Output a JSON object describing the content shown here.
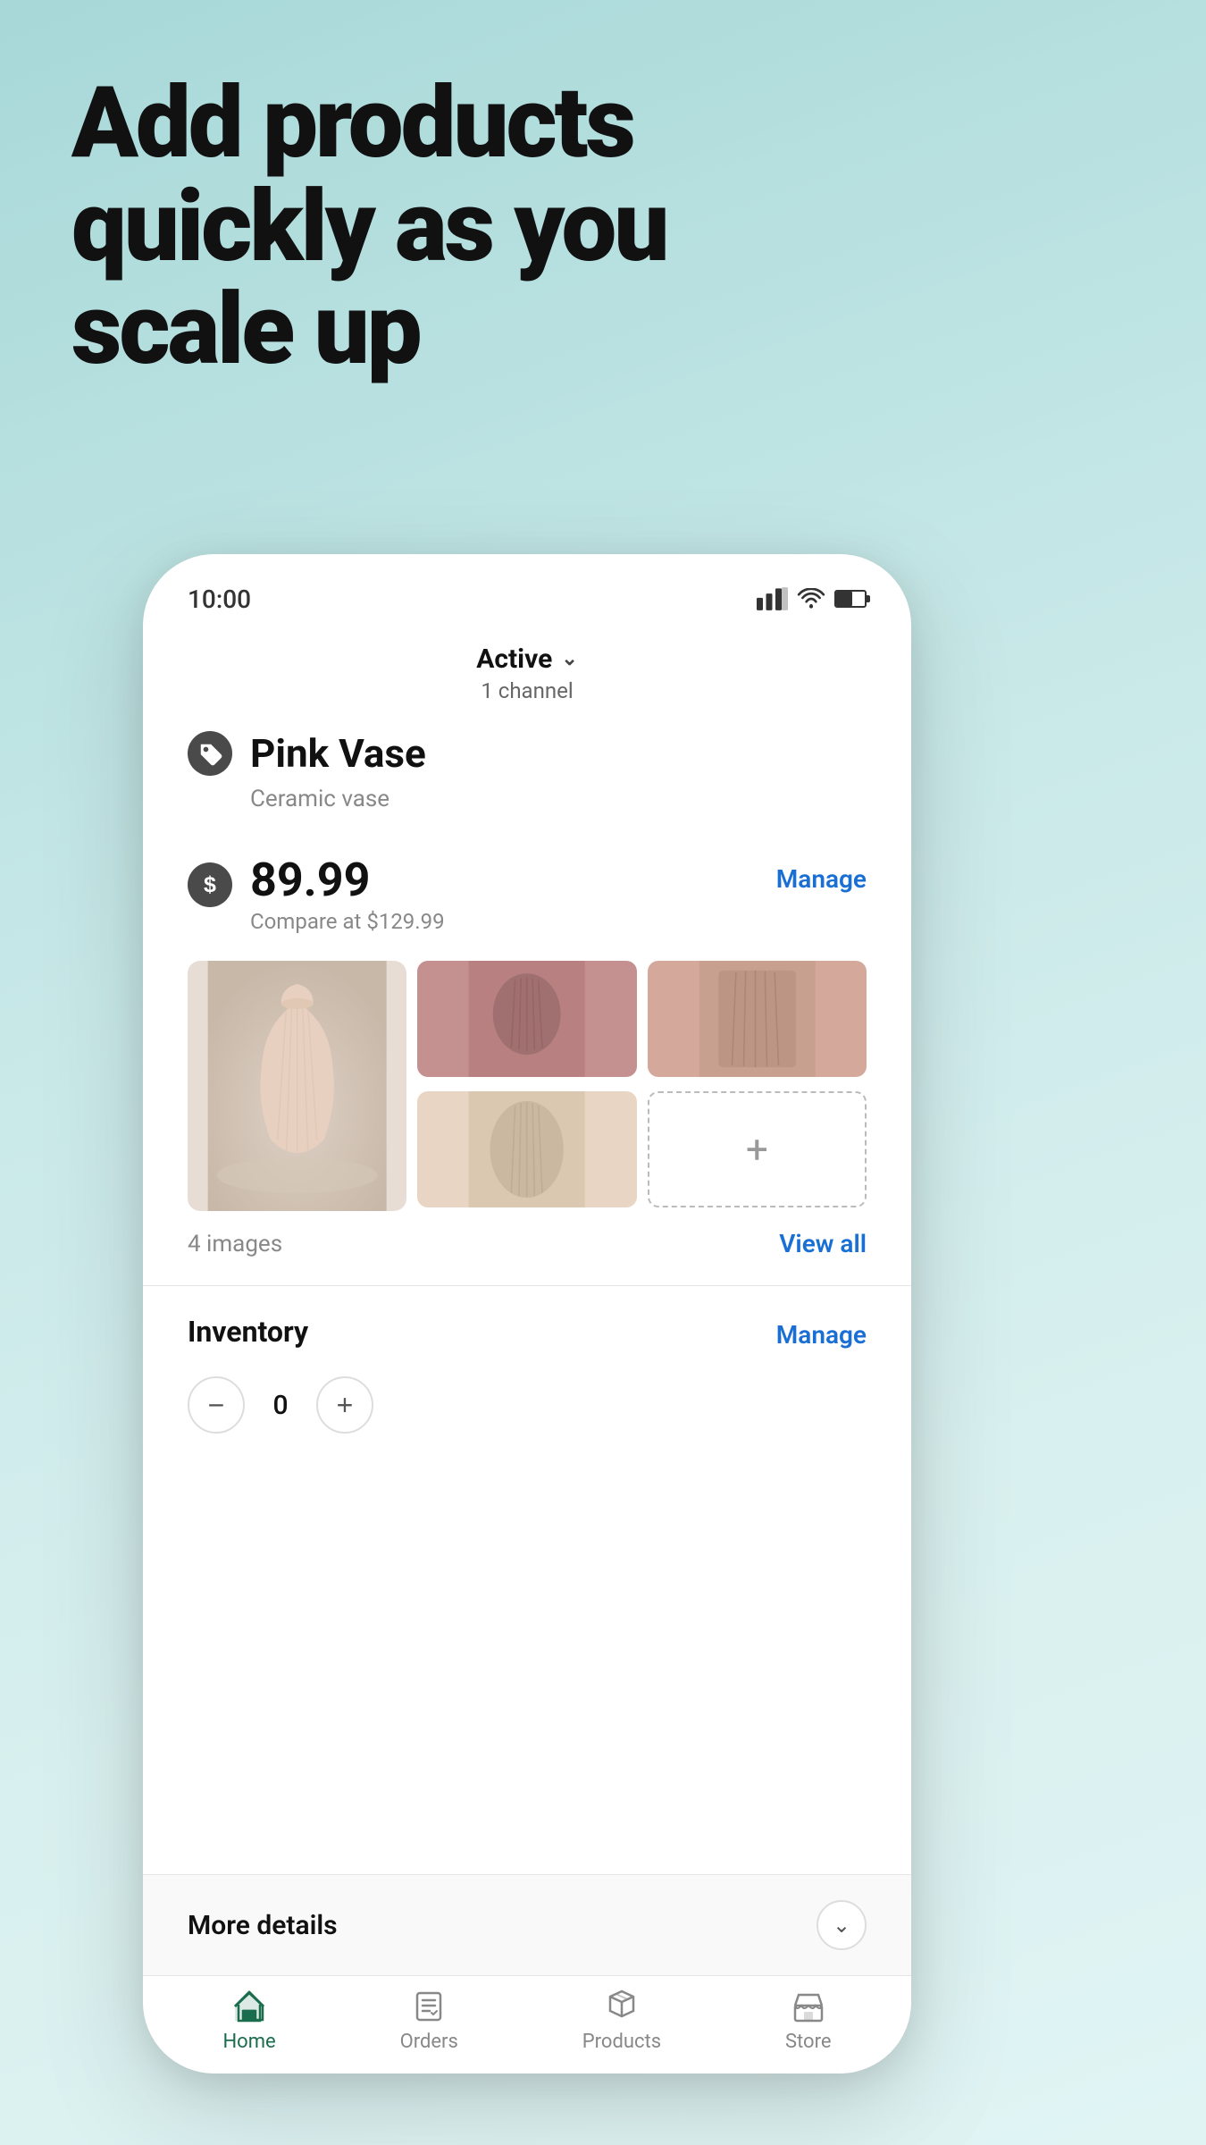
{
  "hero": {
    "line1": "Add products",
    "line2": "quickly as you",
    "line3": "scale up"
  },
  "status_bar": {
    "time": "10:00"
  },
  "product_header": {
    "status": "Active",
    "channel_info": "1 channel"
  },
  "product": {
    "name": "Pink Vase",
    "type": "Ceramic vase",
    "price": "89.99",
    "compare_at": "Compare at $129.99",
    "images_count": "4 images",
    "manage_price_label": "Manage",
    "view_all_label": "View all",
    "inventory_label": "Inventory",
    "inventory_manage_label": "Manage",
    "inventory_qty": "0"
  },
  "more_details": {
    "label": "More details"
  },
  "bottom_nav": {
    "items": [
      {
        "label": "Home",
        "active": true
      },
      {
        "label": "Orders",
        "active": false
      },
      {
        "label": "Products",
        "active": false
      },
      {
        "label": "Store",
        "active": false
      }
    ]
  },
  "qty_controls": {
    "minus": "−",
    "plus": "+"
  }
}
